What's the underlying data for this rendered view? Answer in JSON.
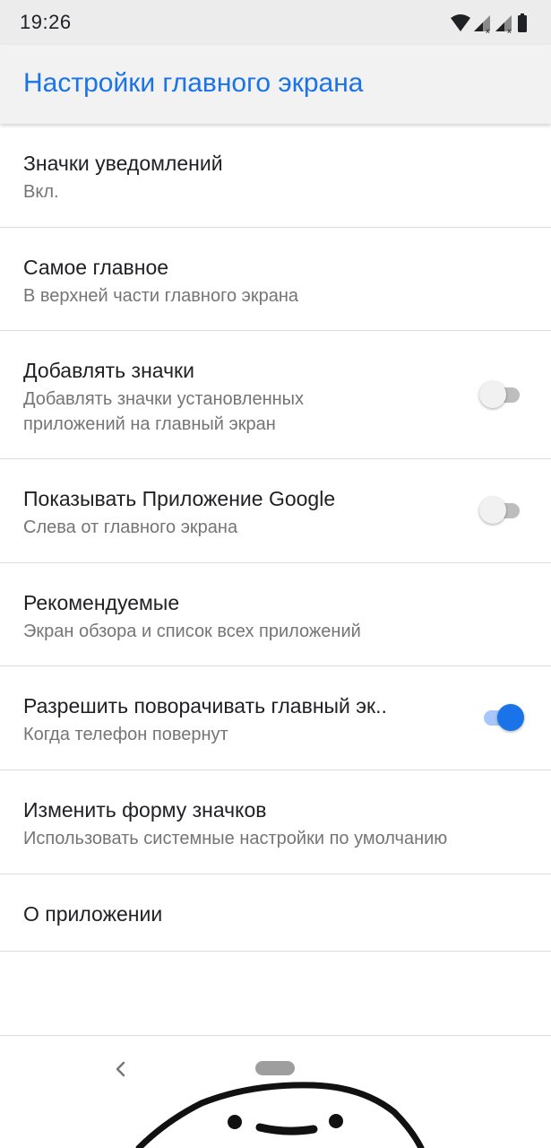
{
  "status_bar": {
    "time": "19:26",
    "icons": [
      "wifi-icon",
      "signal-icon",
      "signal-icon",
      "battery-icon"
    ]
  },
  "app_bar": {
    "title": "Настройки главного экрана"
  },
  "settings": [
    {
      "title": "Значки уведомлений",
      "subtitle": "Вкл."
    },
    {
      "title": "Самое главное",
      "subtitle": "В верхней части главного экрана"
    },
    {
      "title": "Добавлять значки",
      "subtitle_lines": [
        "Добавлять значки установленных",
        "приложений на главный экран"
      ],
      "toggle": "off"
    },
    {
      "title": "Показывать Приложение Google",
      "subtitle": "Слева от главного экрана",
      "toggle": "off"
    },
    {
      "title": "Рекомендуемые",
      "subtitle": "Экран обзора и список всех приложений"
    },
    {
      "title": "Разрешить поворачивать главный эк..",
      "subtitle": "Когда телефон повернут",
      "toggle": "on"
    },
    {
      "title": "Изменить форму значков",
      "subtitle": "Использовать системные настройки по умолчанию"
    },
    {
      "title": "О приложении"
    }
  ],
  "navigation": {
    "icons": [
      "back-icon",
      "home-pill-icon"
    ]
  },
  "colors": {
    "accent": "#1a73e8",
    "status_bar_bg": "#ececec",
    "app_bar_bg": "#f2f2f2",
    "primary_text": "#202124",
    "secondary_text": "#757575"
  }
}
